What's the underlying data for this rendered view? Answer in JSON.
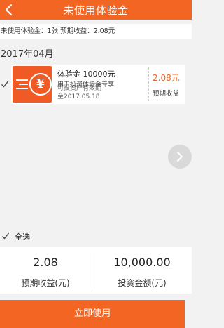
{
  "header": {
    "title": "未使用体验金",
    "back_icon": "chevron-left-icon"
  },
  "summary": {
    "text": "未使用体验金：1张   预期收益：2.08元"
  },
  "group": {
    "month": "2017年04月"
  },
  "card": {
    "checked": true,
    "icon": "yuan-coin-icon",
    "icon_glyph": "¥",
    "name": "体验金 10000元",
    "usage_line1": "用于投资体验金专享",
    "usage_line2": "可投资产有效期",
    "expiry": "至2017.05.18",
    "amount": "2.08元",
    "amount_label": "预期收益"
  },
  "pager": {
    "next_icon": "chevron-right-icon"
  },
  "select_all": {
    "label": "全选",
    "checked": true
  },
  "stats": {
    "expected_value": "2.08",
    "expected_label": "预期收益(元)",
    "invest_value": "10,000.00",
    "invest_label": "投资金额(元)"
  },
  "action": {
    "use_now_label": "立即使用"
  },
  "colors": {
    "accent": "#f26522",
    "background": "#f2f2f2"
  }
}
